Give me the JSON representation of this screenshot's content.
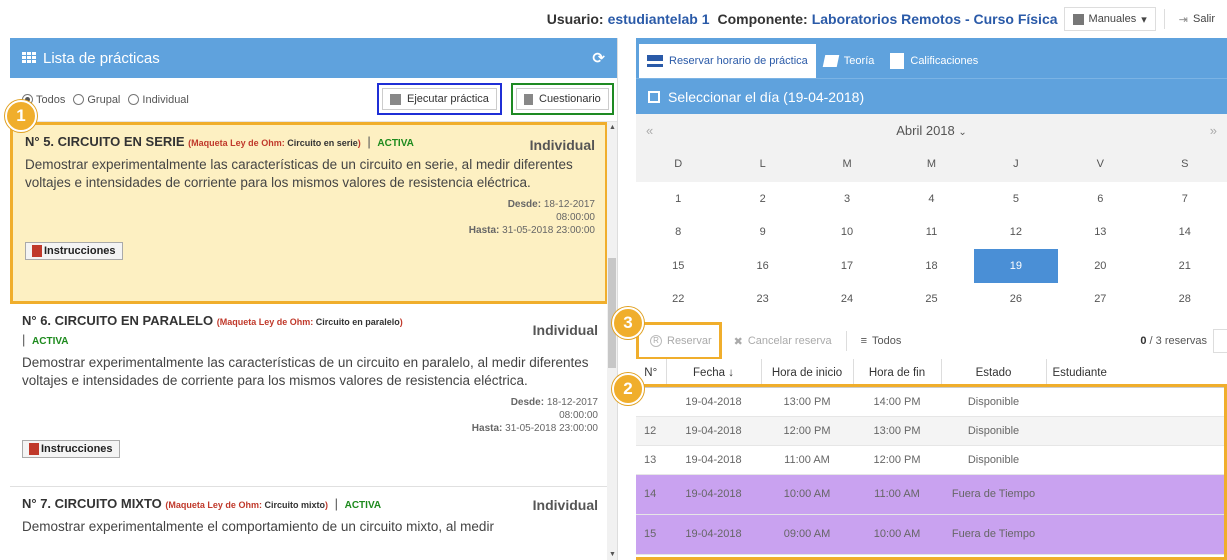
{
  "topbar": {
    "user_label": "Usuario:",
    "user_value": "estudiantelab 1",
    "component_label": "Componente:",
    "component_value": "Laboratorios Remotos - Curso Física",
    "manuals_label": "Manuales",
    "exit_label": "Salir"
  },
  "left": {
    "title": "Lista de prácticas",
    "refresh_icon": "refresh-icon",
    "filters": [
      "Todos",
      "Grupal",
      "Individual"
    ],
    "selected_filter": "Todos",
    "run_button": "Ejecutar práctica",
    "quiz_button": "Cuestionario",
    "items": [
      {
        "title": "N° 5. CIRCUITO EN SERIE",
        "maqueta_label": "Maqueta Ley de Ohm:",
        "maqueta_value": "Circuito en serie",
        "status": "ACTIVA",
        "type": "Individual",
        "description": "Demostrar experimentalmente las características de un circuito en serie, al medir diferentes voltajes e intensidades de corriente para los mismos valores de resistencia eléctrica.",
        "desde_label": "Desde:",
        "desde_date": "18-12-2017",
        "desde_time": "08:00:00",
        "hasta_label": "Hasta:",
        "hasta": "31-05-2018 23:00:00",
        "instructions": "Instrucciones"
      },
      {
        "title": "N° 6. CIRCUITO EN PARALELO",
        "maqueta_label": "Maqueta Ley de Ohm:",
        "maqueta_value": "Circuito en paralelo",
        "status": "ACTIVA",
        "type": "Individual",
        "description": "Demostrar experimentalmente las características de un circuito en paralelo, al medir diferentes voltajes e intensidades de corriente para los mismos valores de resistencia eléctrica.",
        "desde_label": "Desde:",
        "desde_date": "18-12-2017",
        "desde_time": "08:00:00",
        "hasta_label": "Hasta:",
        "hasta": "31-05-2018 23:00:00",
        "instructions": "Instrucciones"
      },
      {
        "title": "N° 7. CIRCUITO MIXTO",
        "maqueta_label": "Maqueta Ley de Ohm:",
        "maqueta_value": "Circuito mixto",
        "status": "ACTIVA",
        "type": "Individual",
        "description": "Demostrar experimentalmente el comportamiento de un circuito mixto, al medir"
      }
    ]
  },
  "right": {
    "tabs": [
      "Reservar horario de práctica",
      "Teoría",
      "Calificaciones"
    ],
    "day_header": "Seleccionar el día (19-04-2018)",
    "calendar": {
      "month": "Abril 2018",
      "prev": "«",
      "next": "»",
      "weekdays": [
        "D",
        "L",
        "M",
        "M",
        "J",
        "V",
        "S"
      ],
      "weeks": [
        [
          "1",
          "2",
          "3",
          "4",
          "5",
          "6",
          "7"
        ],
        [
          "8",
          "9",
          "10",
          "11",
          "12",
          "13",
          "14"
        ],
        [
          "15",
          "16",
          "17",
          "18",
          "19",
          "20",
          "21"
        ],
        [
          "22",
          "23",
          "24",
          "25",
          "26",
          "27",
          "28"
        ]
      ],
      "selected": "19"
    },
    "toolbar": {
      "reserve": "Reservar",
      "cancel": "Cancelar reserva",
      "all": "Todos",
      "count_value": "0",
      "count_rest": "/ 3 reservas"
    },
    "grid": {
      "headers": [
        "N°",
        "Fecha",
        "Hora de inicio",
        "Hora de fin",
        "Estado",
        "Estudiante"
      ],
      "rows": [
        {
          "n": "",
          "fecha": "19-04-2018",
          "inicio": "13:00 PM",
          "fin": "14:00 PM",
          "estado": "Disponible",
          "style": "plain"
        },
        {
          "n": "12",
          "fecha": "19-04-2018",
          "inicio": "12:00 PM",
          "fin": "13:00 PM",
          "estado": "Disponible",
          "style": "alt"
        },
        {
          "n": "13",
          "fecha": "19-04-2018",
          "inicio": "11:00 AM",
          "fin": "12:00 PM",
          "estado": "Disponible",
          "style": "plain"
        },
        {
          "n": "14",
          "fecha": "19-04-2018",
          "inicio": "10:00 AM",
          "fin": "11:00 AM",
          "estado": "Fuera de Tiempo",
          "style": "out"
        },
        {
          "n": "15",
          "fecha": "19-04-2018",
          "inicio": "09:00 AM",
          "fin": "10:00 AM",
          "estado": "Fuera de Tiempo",
          "style": "out"
        }
      ]
    }
  },
  "badges": [
    "1",
    "2",
    "3"
  ],
  "colors": {
    "header_blue": "#5fa2dd",
    "highlight_orange": "#f0ae2c",
    "active_bg": "#fdf0c2",
    "status_green": "#1d8a1d",
    "out_of_time_purple": "#c9a2f0",
    "selected_day": "#4a8fd6"
  }
}
